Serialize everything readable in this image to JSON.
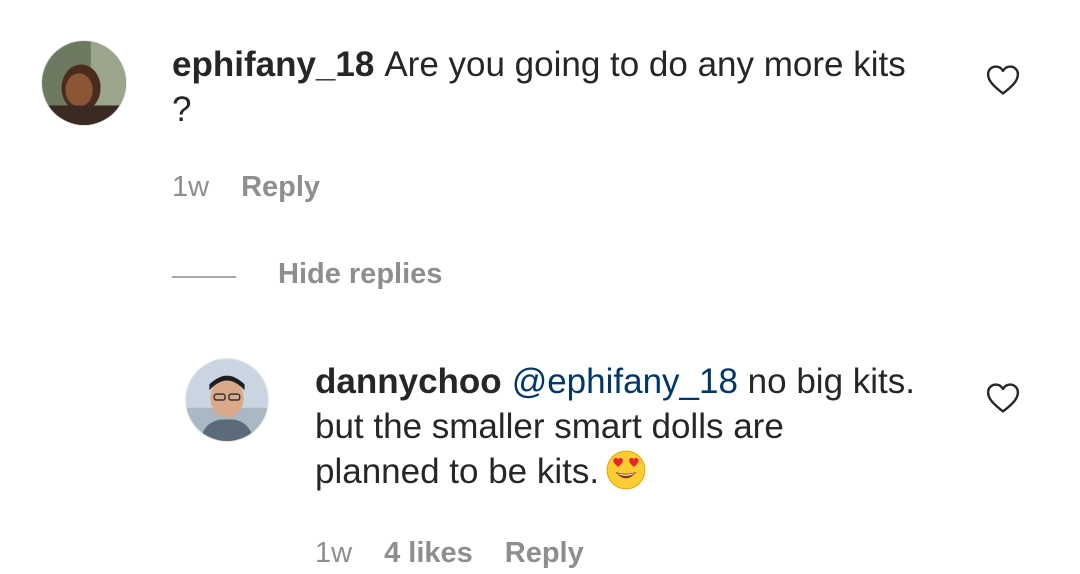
{
  "comment": {
    "username": "ephifany_18",
    "text": "Are you going to do any more kits",
    "text_line2": "?",
    "time": "1w",
    "reply_label": "Reply",
    "like_icon": "heart-outline-icon"
  },
  "hide_replies_label": "Hide replies",
  "reply": {
    "username": "dannychoo",
    "mention": "@ephifany_18",
    "text_line1": " no big kits.",
    "text_line2": "but the smaller smart dolls are",
    "text_line3": "planned to be kits.",
    "emoji": "smiling-face-with-heart-eyes-icon",
    "time": "1w",
    "likes": "4 likes",
    "reply_label": "Reply",
    "like_icon": "heart-outline-icon"
  },
  "colors": {
    "text": "#262626",
    "secondary": "#8e8e8e",
    "mention": "#00376b"
  }
}
